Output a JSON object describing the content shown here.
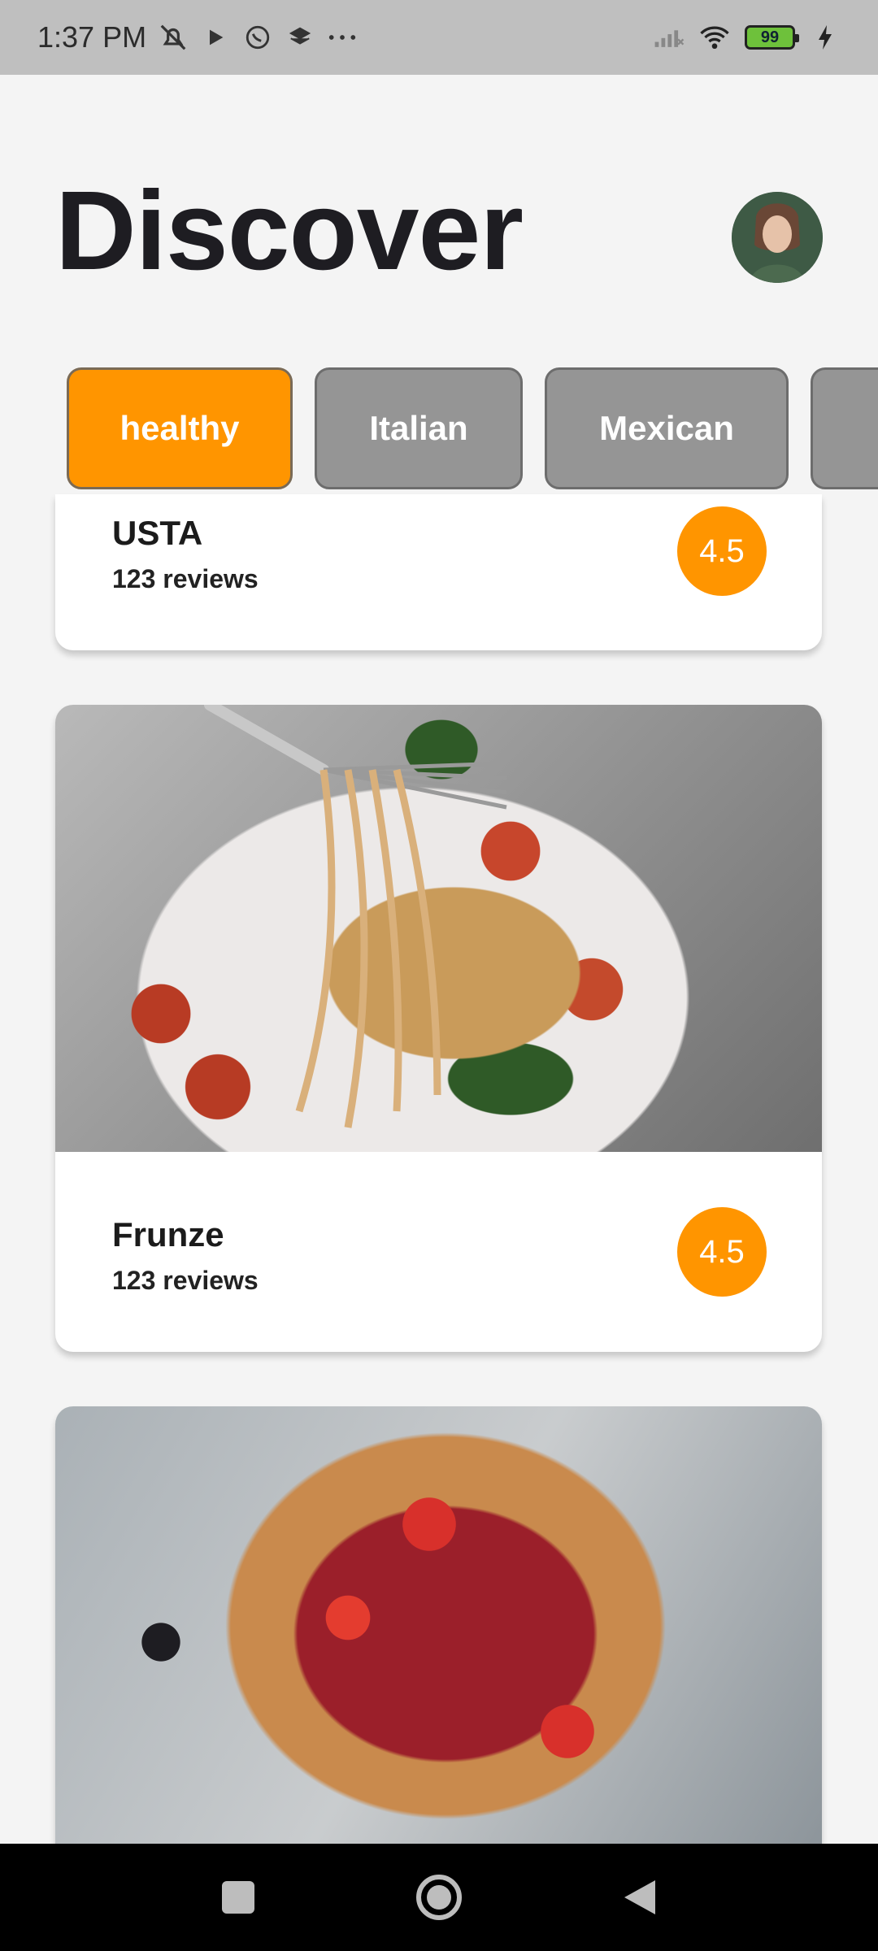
{
  "status_bar": {
    "time": "1:37 PM",
    "battery": "99",
    "icons": [
      "mute-icon",
      "play-icon",
      "whatsapp-icon",
      "layers-icon",
      "more-dots-icon",
      "signal-icon",
      "wifi-icon",
      "battery-icon",
      "charging-icon"
    ]
  },
  "header": {
    "title": "Discover"
  },
  "categories": [
    {
      "label": "healthy",
      "selected": true
    },
    {
      "label": "Italian",
      "selected": false
    },
    {
      "label": "Mexican",
      "selected": false
    }
  ],
  "restaurants": [
    {
      "name": "USTA",
      "reviews": "123 reviews",
      "rating": "4.5"
    },
    {
      "name": "Frunze",
      "reviews": "123 reviews",
      "rating": "4.5"
    }
  ],
  "colors": {
    "accent": "#ff9500",
    "chip_inactive": "#959595",
    "background": "#f4f4f4"
  },
  "nav_bar": {
    "icons": [
      "recents-square-icon",
      "home-circle-icon",
      "back-triangle-icon"
    ]
  }
}
